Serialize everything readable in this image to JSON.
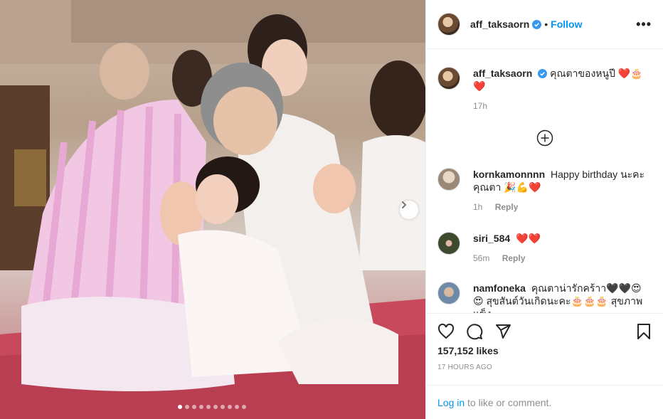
{
  "post": {
    "username": "aff_taksaorn",
    "follow_label": "Follow",
    "bullet": "•",
    "more_label": "•••",
    "photo_dot_count": 10,
    "active_dot_index": 0
  },
  "caption": {
    "username": "aff_taksaorn",
    "text": "คุณตาของหนูปี",
    "emoji": "❤️🎂 ❤️",
    "time": "17h"
  },
  "comments": [
    {
      "username": "kornkamonnnn",
      "text": "Happy birthday นะคะ คุณตา 🎉💪❤️",
      "time": "1h",
      "reply": "Reply"
    },
    {
      "username": "siri_584",
      "text": "❤️❤️",
      "time": "56m",
      "reply": "Reply"
    },
    {
      "username": "namfoneka",
      "text": "คุณตาน่ารักคร้าา🖤🖤😍😍 สุขสันต์วันเกิดนะคะ🎂🎂🎂 สุขภาพแข็ง",
      "time": "",
      "reply": ""
    }
  ],
  "footer": {
    "likes": "157,152 likes",
    "timestamp": "17 HOURS AGO",
    "login_link": "Log in",
    "login_rest": " to like or comment."
  },
  "colors": {
    "accent": "#0095f6",
    "heart": "#e0245e",
    "muted": "#8e8e8e"
  }
}
